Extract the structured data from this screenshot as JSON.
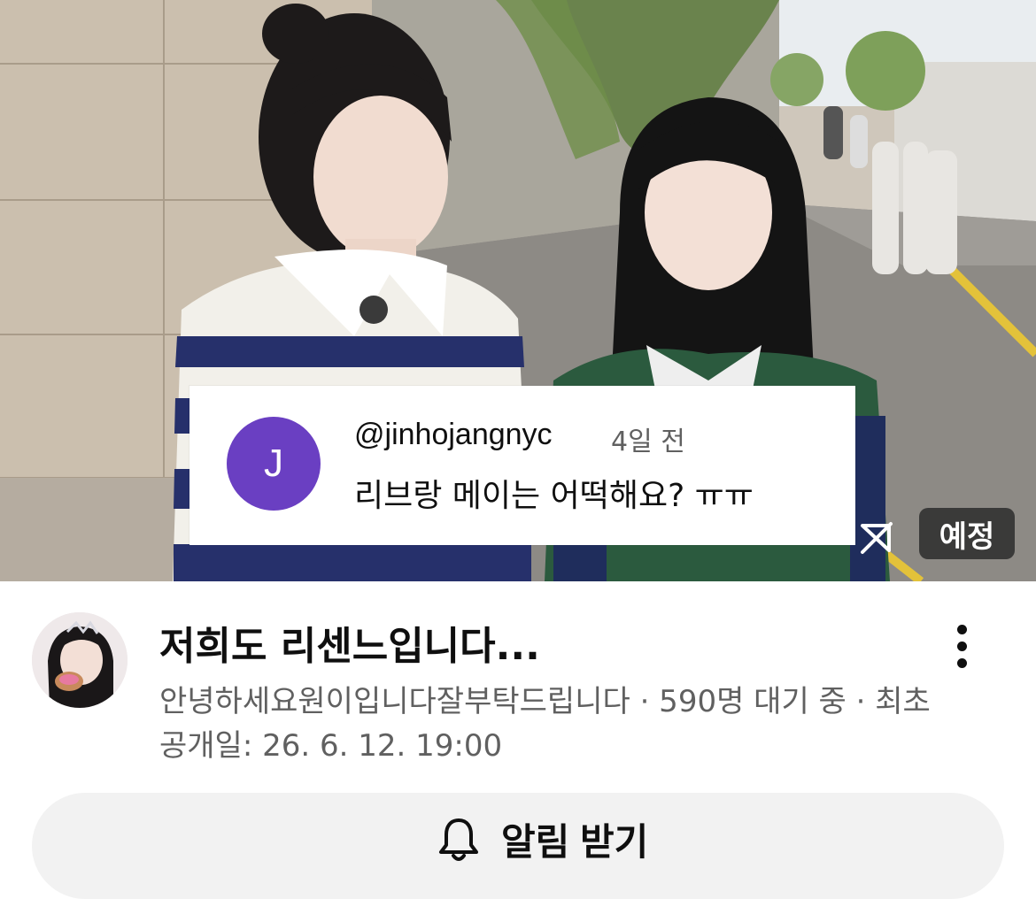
{
  "comment": {
    "avatar_letter": "J",
    "avatar_color": "#6a3fc2",
    "handle": "@jinhojangnyc",
    "time": "4일 전",
    "text": "리브랑 메이는 어떡해요? ㅠㅠ"
  },
  "player": {
    "badge": "예정",
    "cast_icon": "cast-icon"
  },
  "video": {
    "title": "저희도 리센느입니다...",
    "meta": "안녕하세요원이입니다잘부탁드립니다 · 590명 대기 중 · 최초 공개일: 26. 6. 12. 19:00"
  },
  "subscribe": {
    "icon": "bell-icon",
    "label": "알림 받기"
  }
}
